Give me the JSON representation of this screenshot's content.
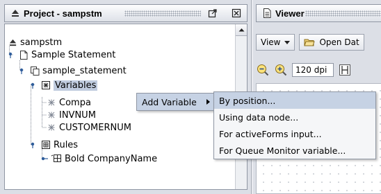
{
  "project_panel": {
    "title": "Project - sampstm",
    "tree": {
      "root": "sampstm",
      "statement": "Sample Statement",
      "source": "sample_statement",
      "variables": "Variables",
      "var_items": [
        "Compa",
        "INVNUM",
        "CUSTOMERNUM"
      ],
      "rules": "Rules",
      "rule_items": [
        "Bold CompanyName"
      ]
    }
  },
  "viewer_panel": {
    "title": "Viewer",
    "view_button": "View",
    "open_button": "Open Dat",
    "dpi_value": "120 dpi"
  },
  "context_menu": {
    "add_variable": "Add Variable",
    "submenu": [
      "By position...",
      "Using data node...",
      "For activeForms input...",
      "For Queue Monitor variable..."
    ]
  },
  "colors": {
    "selection": "#c0ccdf",
    "menu_highlight": "#c6d2e4",
    "panel_bg": "#dcdfe6"
  }
}
